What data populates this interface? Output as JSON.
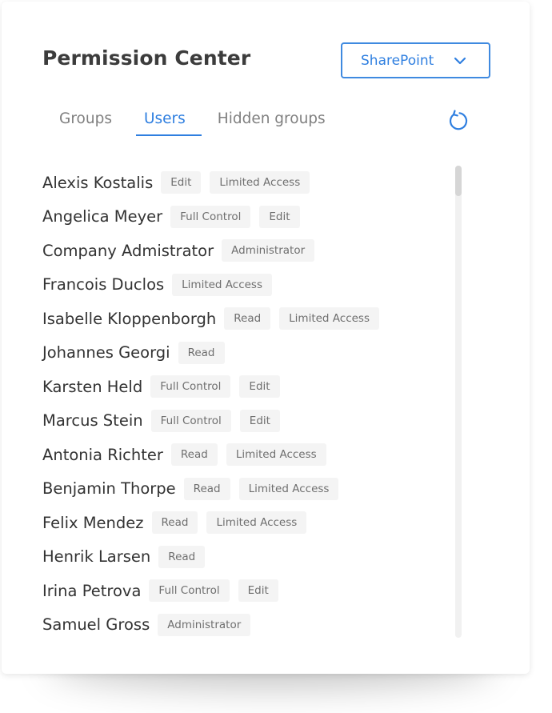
{
  "header": {
    "title": "Permission Center",
    "dropdown_value": "SharePoint"
  },
  "tabs": [
    {
      "label": "Groups",
      "active": false
    },
    {
      "label": "Users",
      "active": true
    },
    {
      "label": "Hidden groups",
      "active": false
    }
  ],
  "icons": {
    "dropdown": "chevron-down-icon",
    "refresh": "refresh-icon"
  },
  "colors": {
    "accent": "#2f7fe0",
    "badge_bg": "#f4f4f4",
    "title": "#3c3c3c"
  },
  "users": [
    {
      "name": "Alexis Kostalis",
      "permissions": [
        "Edit",
        "Limited Access"
      ]
    },
    {
      "name": "Angelica Meyer",
      "permissions": [
        "Full Control",
        "Edit"
      ]
    },
    {
      "name": "Company Admistrator",
      "permissions": [
        "Administrator"
      ]
    },
    {
      "name": "Francois Duclos",
      "permissions": [
        "Limited Access"
      ]
    },
    {
      "name": "Isabelle Kloppenborgh",
      "permissions": [
        "Read",
        "Limited Access"
      ]
    },
    {
      "name": "Johannes Georgi",
      "permissions": [
        "Read"
      ]
    },
    {
      "name": "Karsten Held",
      "permissions": [
        "Full Control",
        "Edit"
      ]
    },
    {
      "name": "Marcus Stein",
      "permissions": [
        "Full Control",
        "Edit"
      ]
    },
    {
      "name": "Antonia Richter",
      "permissions": [
        "Read",
        "Limited Access"
      ]
    },
    {
      "name": "Benjamin Thorpe",
      "permissions": [
        "Read",
        "Limited Access"
      ]
    },
    {
      "name": "Felix Mendez",
      "permissions": [
        "Read",
        "Limited Access"
      ]
    },
    {
      "name": "Henrik Larsen",
      "permissions": [
        "Read"
      ]
    },
    {
      "name": "Irina Petrova",
      "permissions": [
        "Full Control",
        "Edit"
      ]
    },
    {
      "name": "Samuel Gross",
      "permissions": [
        "Administrator"
      ]
    }
  ]
}
